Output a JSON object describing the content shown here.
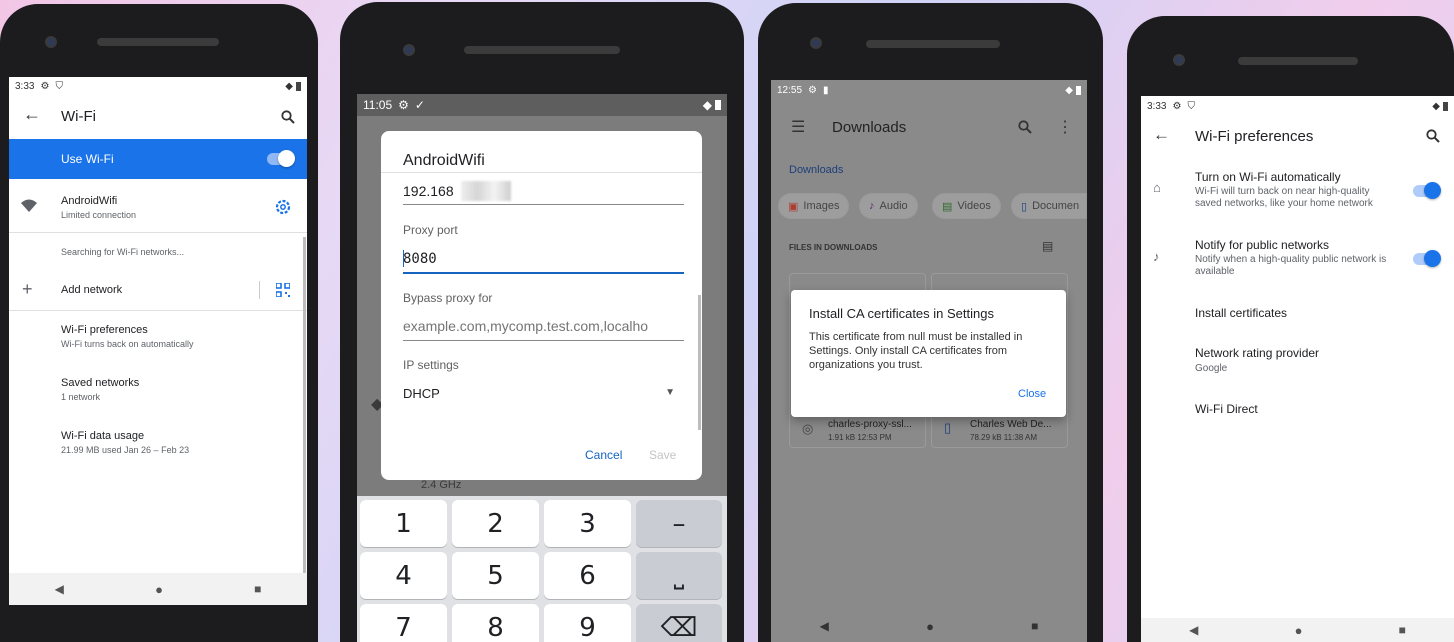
{
  "phone1": {
    "status_time": "3:33",
    "title": "Wi-Fi",
    "use_wifi_label": "Use Wi-Fi",
    "network_name": "AndroidWifi",
    "network_status": "Limited connection",
    "searching_text": "Searching for Wi-Fi networks...",
    "add_network_label": "Add network",
    "items": [
      {
        "title": "Wi-Fi preferences",
        "subtitle": "Wi-Fi turns back on automatically"
      },
      {
        "title": "Saved networks",
        "subtitle": "1 network"
      },
      {
        "title": "Wi-Fi data usage",
        "subtitle": "21.99 MB used Jan 26 – Feb 23"
      }
    ]
  },
  "phone2": {
    "status_time": "11:05",
    "dialog_title": "AndroidWifi",
    "proxy_host_value": "192.168",
    "proxy_port_label": "Proxy port",
    "proxy_port_value": "8080",
    "bypass_label": "Bypass proxy for",
    "bypass_placeholder": "example.com,mycomp.test.com,localho",
    "ip_settings_label": "IP settings",
    "ip_settings_value": "DHCP",
    "cancel_label": "Cancel",
    "save_label": "Save",
    "behind_text": "2.4 GHz",
    "keys": [
      "1",
      "2",
      "3",
      "–",
      "4",
      "5",
      "6",
      "⎵",
      "7",
      "8",
      "9",
      "⌫"
    ]
  },
  "phone3": {
    "status_time": "12:55",
    "title": "Downloads",
    "breadcrumb": "Downloads",
    "chips": [
      "Images",
      "Audio",
      "Videos",
      "Documen"
    ],
    "section_label": "FILES IN DOWNLOADS",
    "files": [
      {
        "name": "charles-proxy-ssl...",
        "meta": "1.91 kB 12:53 PM"
      },
      {
        "name": "Charles Web De...",
        "meta": "78.29 kB 11:38 AM"
      }
    ],
    "dialog_title": "Install CA certificates in Settings",
    "dialog_body": "This certificate from null must be installed in Settings. Only install CA certificates from organizations you trust.",
    "close_label": "Close"
  },
  "phone4": {
    "status_time": "3:33",
    "title": "Wi-Fi preferences",
    "turn_on_title": "Turn on Wi-Fi automatically",
    "turn_on_subtitle": "Wi-Fi will turn back on near high-quality saved networks, like your home network",
    "notify_title": "Notify for public networks",
    "notify_subtitle": "Notify when a high-quality public network is available",
    "install_certs": "Install certificates",
    "rating_title": "Network rating provider",
    "rating_subtitle": "Google",
    "wifi_direct": "Wi-Fi Direct"
  },
  "colors": {
    "accent": "#1a73e8",
    "dialog_accent": "#1565c0",
    "scrim": "#8a8a8a"
  }
}
